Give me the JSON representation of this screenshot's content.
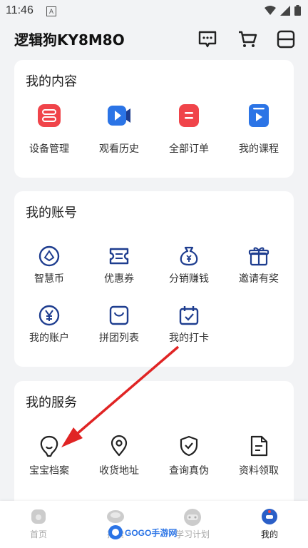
{
  "status": {
    "time": "11:46",
    "notif": "A"
  },
  "header": {
    "title": "逻辑狗KY8M8O"
  },
  "content": {
    "title": "我的内容",
    "items": [
      {
        "label": "设备管理",
        "icon": "device-icon"
      },
      {
        "label": "观看历史",
        "icon": "history-icon"
      },
      {
        "label": "全部订单",
        "icon": "orders-icon"
      },
      {
        "label": "我的课程",
        "icon": "course-icon"
      }
    ]
  },
  "account": {
    "title": "我的账号",
    "items": [
      {
        "label": "智慧币",
        "icon": "coin-icon"
      },
      {
        "label": "优惠券",
        "icon": "coupon-icon"
      },
      {
        "label": "分销赚钱",
        "icon": "money-bag-icon"
      },
      {
        "label": "邀请有奖",
        "icon": "gift-icon"
      },
      {
        "label": "我的账户",
        "icon": "yen-icon"
      },
      {
        "label": "拼团列表",
        "icon": "group-buy-icon"
      },
      {
        "label": "我的打卡",
        "icon": "checkin-icon"
      }
    ]
  },
  "services": {
    "title": "我的服务",
    "items": [
      {
        "label": "宝宝档案",
        "icon": "baby-icon"
      },
      {
        "label": "收货地址",
        "icon": "location-icon"
      },
      {
        "label": "查询真伪",
        "icon": "shield-check-icon"
      },
      {
        "label": "资料领取",
        "icon": "document-icon"
      }
    ]
  },
  "tabs": [
    {
      "label": "首页"
    },
    {
      "label": "探索"
    },
    {
      "label": "学习计划"
    },
    {
      "label": "我的"
    }
  ],
  "watermark": "GOGO手游网",
  "colors": {
    "red": "#f0444a",
    "blue": "#2b74e6",
    "navy": "#1e3d8f",
    "arrow": "#e02424"
  }
}
